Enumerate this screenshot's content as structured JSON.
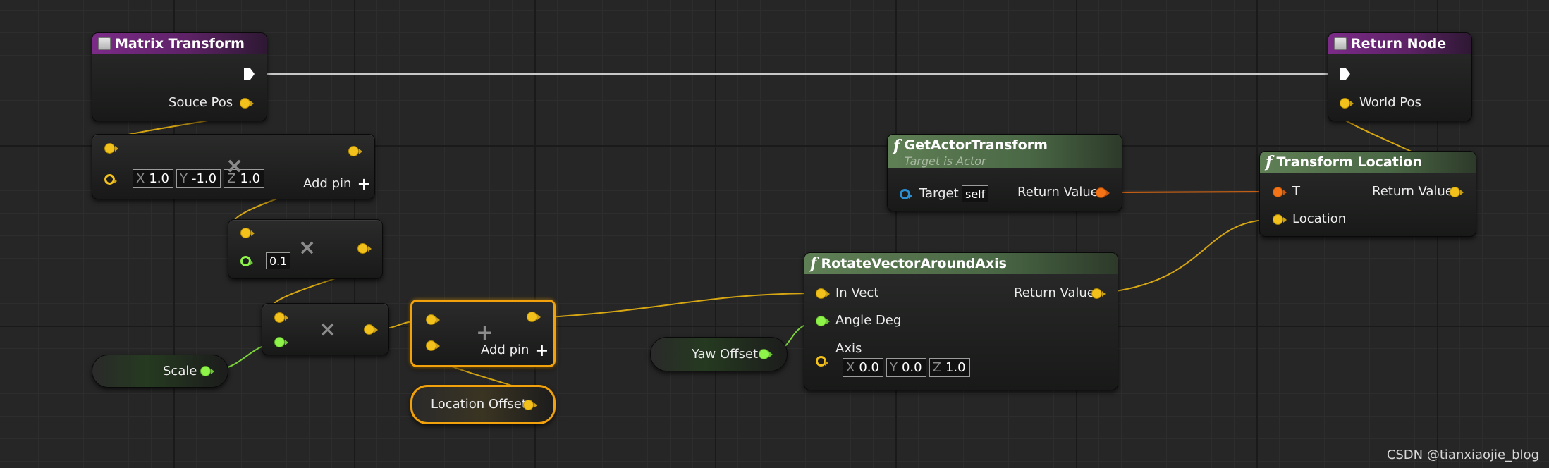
{
  "nodes": {
    "matrix_transform": {
      "title": "Matrix Transform",
      "output_label": "Souce Pos"
    },
    "return_node": {
      "title": "Return Node",
      "input_label": "World Pos"
    },
    "make_vector_multiply": {
      "x_key": "X",
      "x_val": "1.0",
      "y_key": "Y",
      "y_val": "-1.0",
      "z_key": "Z",
      "z_val": "1.0",
      "add_pin": "Add pin"
    },
    "multiply_scalar": {
      "value": "0.1"
    },
    "scale_var": {
      "label": "Scale"
    },
    "add_node": {
      "add_pin": "Add pin"
    },
    "location_offset": {
      "label": "Location Offset"
    },
    "yaw_offset": {
      "label": "Yaw Offset"
    },
    "get_actor_transform": {
      "title": "GetActorTransform",
      "subtitle": "Target is Actor",
      "target_label": "Target",
      "target_value": "self",
      "return_label": "Return Value"
    },
    "rotate_vector": {
      "title": "RotateVectorAroundAxis",
      "in_vect": "In Vect",
      "angle_deg": "Angle Deg",
      "axis": "Axis",
      "return_label": "Return Value",
      "x_key": "X",
      "x_val": "0.0",
      "y_key": "Y",
      "y_val": "0.0",
      "z_key": "Z",
      "z_val": "1.0"
    },
    "transform_location": {
      "title": "Transform Location",
      "t_label": "T",
      "location_label": "Location",
      "return_label": "Return Value"
    }
  },
  "watermark": "CSDN @tianxiaojie_blog",
  "colors": {
    "vector_pin": "#f3c11c",
    "float_pin": "#8ef44a",
    "transform_pin": "#f47316",
    "object_pin": "#2b8fd4",
    "selection": "#f1a10b"
  },
  "icons": {
    "function": "f-icon",
    "event": "event-node-icon",
    "exec": "exec-pin-icon",
    "multiply": "multiply-icon",
    "add": "add-icon"
  }
}
